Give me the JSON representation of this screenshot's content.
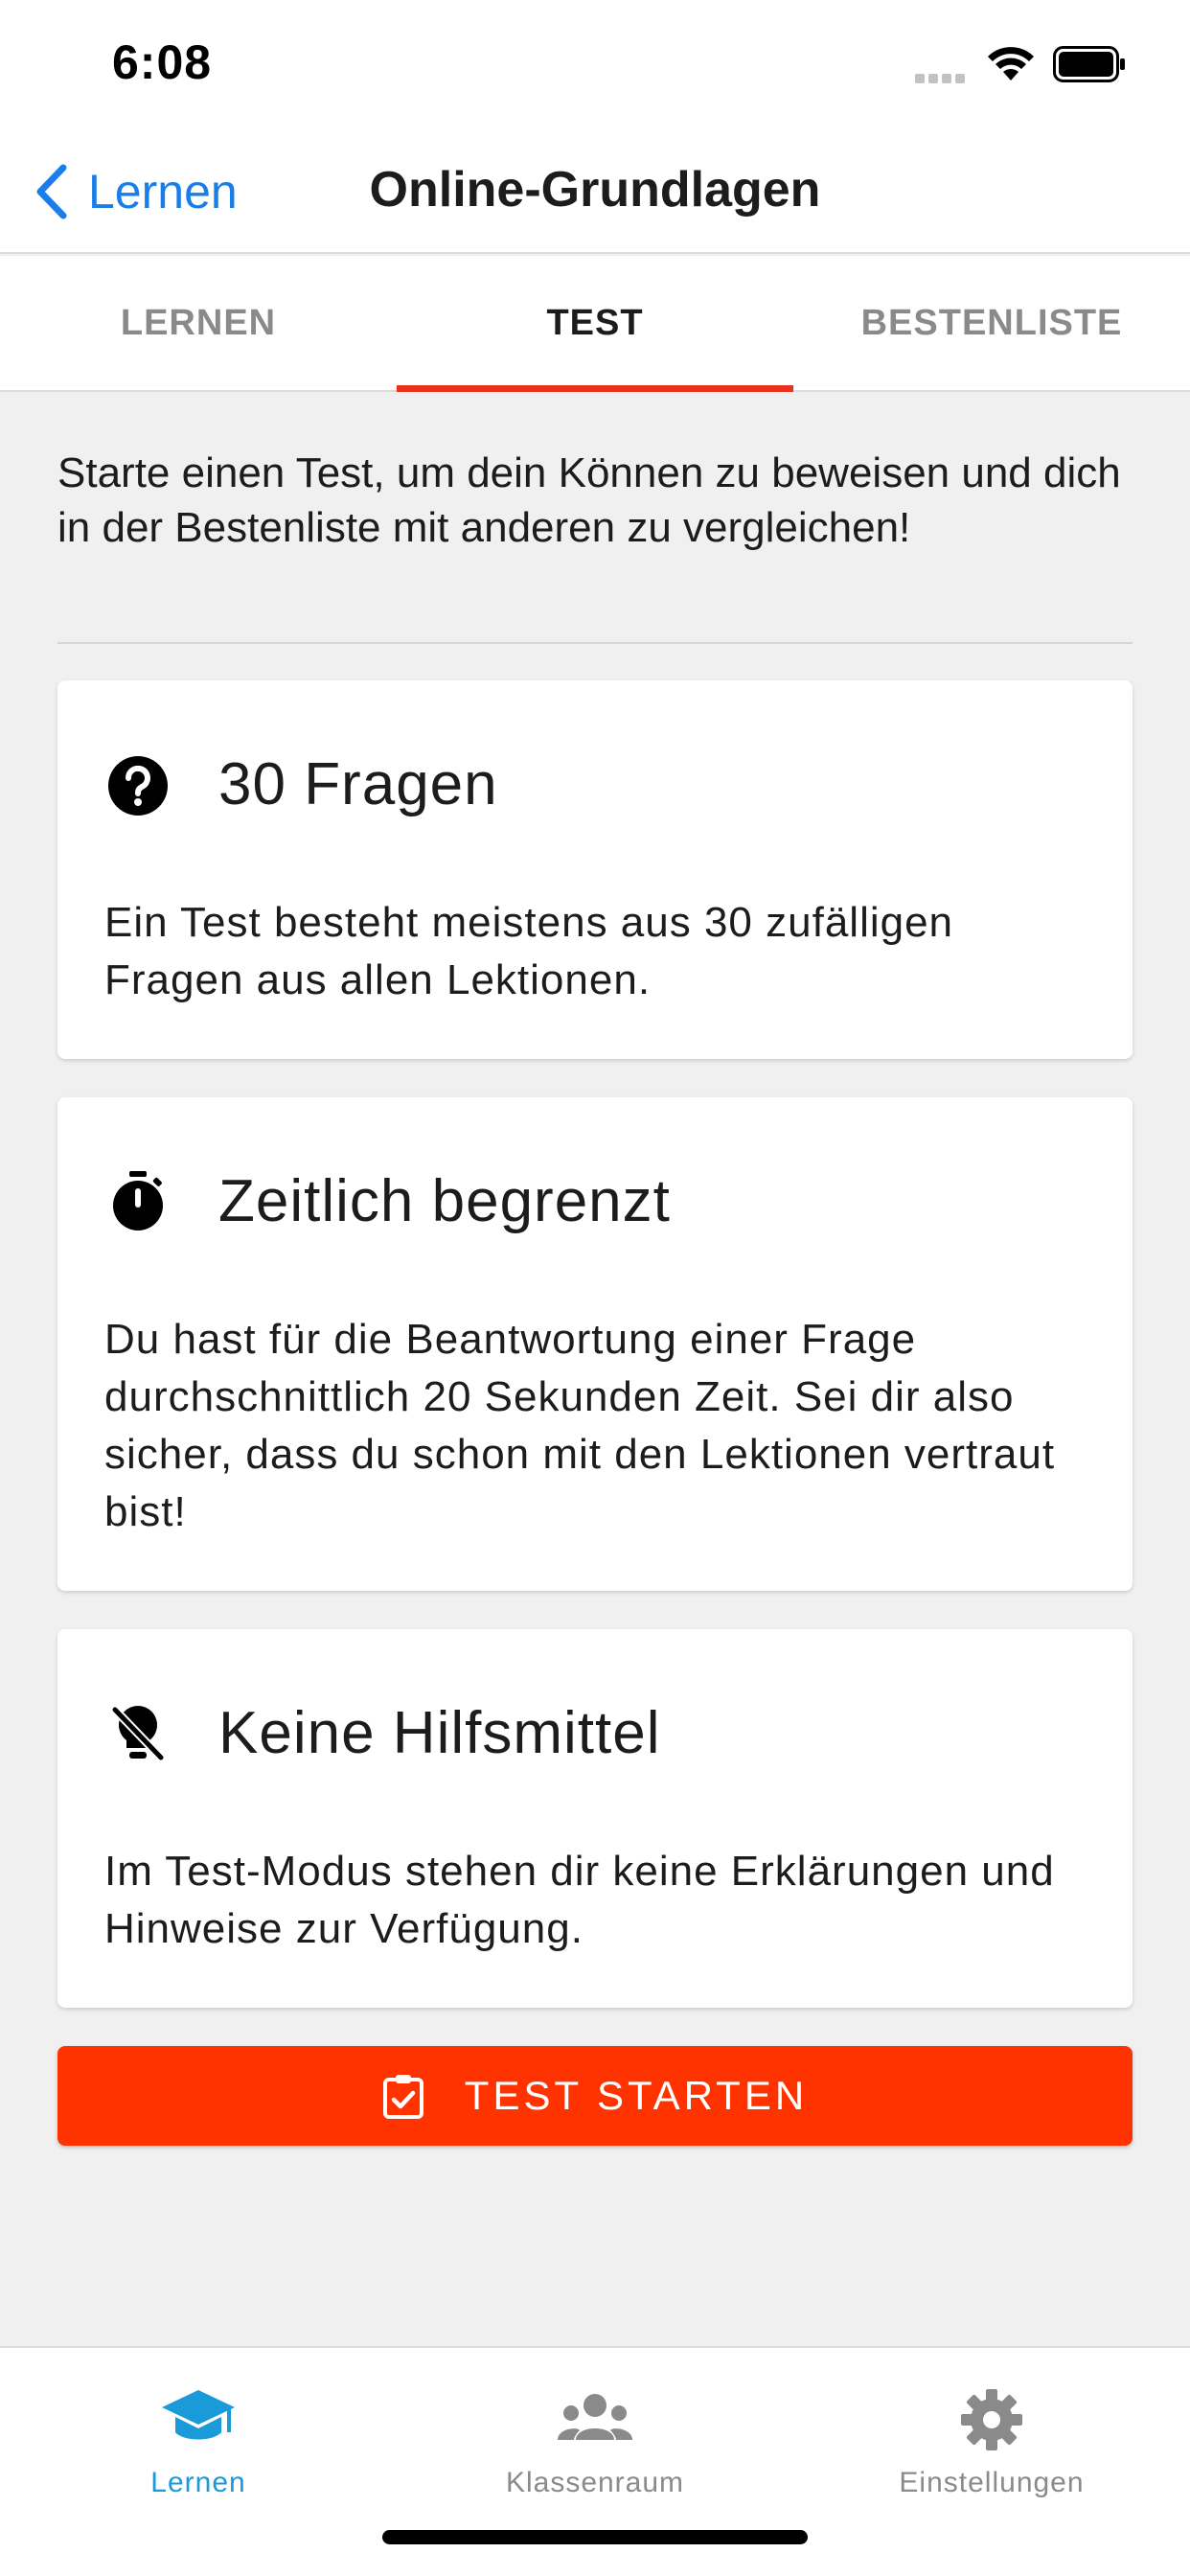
{
  "status_bar": {
    "time": "6:08"
  },
  "nav": {
    "back_label": "Lernen",
    "title": "Online-Grundlagen"
  },
  "tabs": [
    {
      "label": "LERNEN",
      "active": false
    },
    {
      "label": "TEST",
      "active": true
    },
    {
      "label": "BESTENLISTE",
      "active": false
    }
  ],
  "intro": "Starte einen Test, um dein Können zu beweisen und dich in der Bestenliste mit anderen zu vergleichen!",
  "cards": [
    {
      "icon": "help-circle-icon",
      "title": "30 Fragen",
      "description": "Ein Test besteht meistens aus 30 zufälligen Fragen aus allen Lektionen."
    },
    {
      "icon": "stopwatch-icon",
      "title": "Zeitlich begrenzt",
      "description": "Du hast für die Beantwortung einer Frage durchschnittlich 20 Sekunden Zeit. Sei dir also sicher, dass du schon mit den Lektionen vertraut bist!"
    },
    {
      "icon": "lightbulb-off-icon",
      "title": "Keine Hilfsmittel",
      "description": "Im Test-Modus stehen dir keine Erklärungen und Hinweise zur Verfügung."
    }
  ],
  "start_button": {
    "label": "TEST STARTEN",
    "icon": "clipboard-check-icon"
  },
  "tab_bar": [
    {
      "label": "Lernen",
      "icon": "graduation-cap-icon",
      "active": true
    },
    {
      "label": "Klassenraum",
      "icon": "group-icon",
      "active": false
    },
    {
      "label": "Einstellungen",
      "icon": "gear-icon",
      "active": false
    }
  ],
  "colors": {
    "accent_red": "#ff3300",
    "tab_indicator": "#e8321e",
    "link_blue": "#1a7ee8",
    "active_tab_blue": "#1a9ad9",
    "background": "#f0f0f0"
  }
}
